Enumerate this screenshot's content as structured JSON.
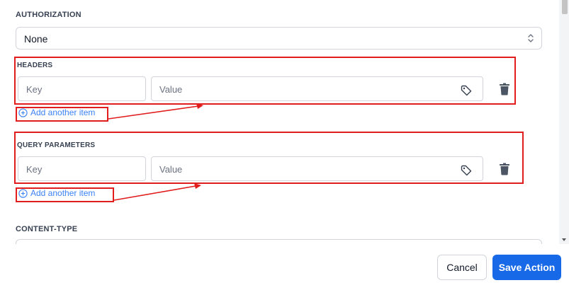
{
  "authorization": {
    "label": "AUTHORIZATION",
    "selected": "None"
  },
  "headers": {
    "label": "HEADERS",
    "key_placeholder": "Key",
    "value_placeholder": "Value",
    "add_label": "Add another item"
  },
  "query_parameters": {
    "label": "QUERY PARAMETERS",
    "key_placeholder": "Key",
    "value_placeholder": "Value",
    "add_label": "Add another item"
  },
  "content_type": {
    "label": "CONTENT-TYPE"
  },
  "footer": {
    "cancel_label": "Cancel",
    "save_label": "Save Action"
  },
  "colors": {
    "accent": "#1769e8",
    "link": "#3b82f6",
    "annotation": "#e11d1d"
  }
}
